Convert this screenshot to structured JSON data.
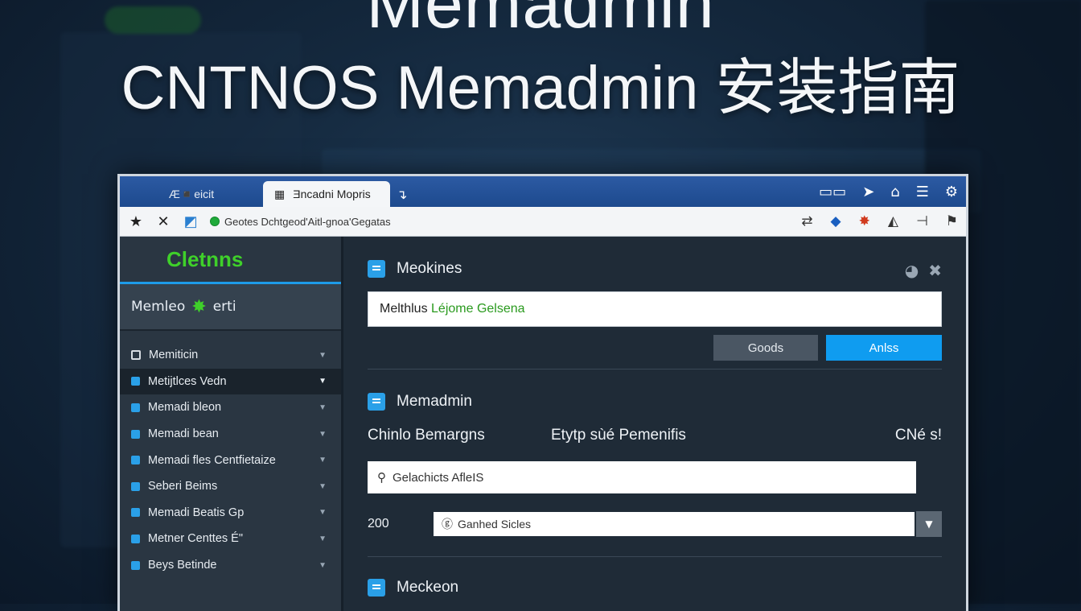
{
  "hero": {
    "top_text": "Memadmin",
    "title": "CNTNOS Memadmin 安装指南"
  },
  "browser": {
    "tabs": [
      {
        "label": "Æ◾eicit",
        "active": false
      },
      {
        "label": "Ǝncadni Mopris",
        "active": true
      }
    ],
    "new_tab": "↴",
    "url": "Geotes Dchtgeod'Aitl-gnoa'Gegatas"
  },
  "sidebar": {
    "brand": "Cletnns",
    "user_label": "Memleo",
    "user_suffix": "erti",
    "items": [
      {
        "label": "Memiticin",
        "active": false
      },
      {
        "label": "Metijtlces Vedn",
        "active": true
      },
      {
        "label": "Memadi bleon",
        "active": false
      },
      {
        "label": "Memadi bean",
        "active": false
      },
      {
        "label": "Memadi fles Centfietaize",
        "active": false
      },
      {
        "label": "Seberi Beims",
        "active": false
      },
      {
        "label": "Memadi Beatis Gp",
        "active": false
      },
      {
        "label": "Metner Centtes É\"",
        "active": false
      },
      {
        "label": "Beys Betinde",
        "active": false
      }
    ]
  },
  "main": {
    "section1": {
      "title": "Meokines",
      "input_prefix": "Melthlus",
      "input_value": "Léjome Gelsena",
      "btn_secondary": "Goods",
      "btn_primary": "Anlss"
    },
    "section2": {
      "title": "Memadmin",
      "label1": "Chinlo Bemargns",
      "label2": "Etytp sùé Pemenifis",
      "label3": "CNé s!",
      "search_value": "Gelachicts AfleIS",
      "num": "200",
      "select_value": "Ganhed Sicles"
    },
    "section3": {
      "title": "Meckeon"
    }
  }
}
